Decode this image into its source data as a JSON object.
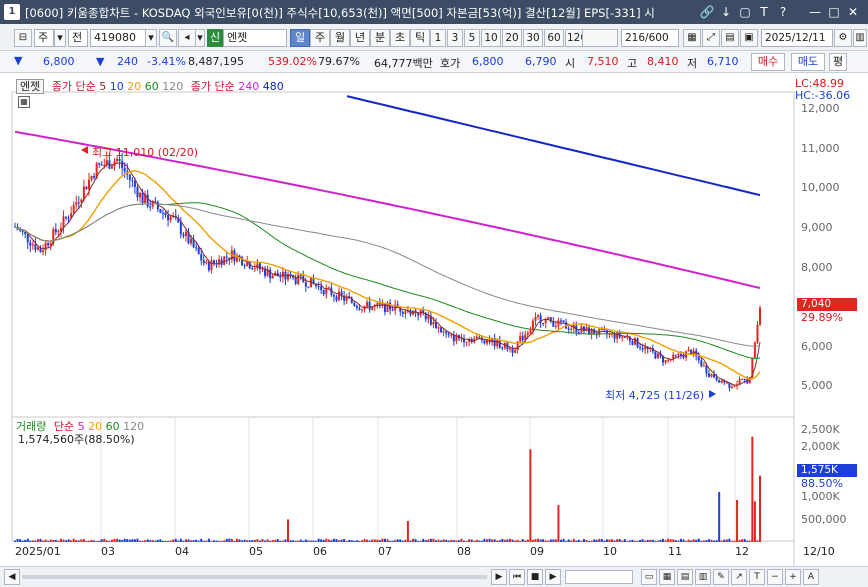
{
  "window": {
    "number": "1",
    "title": "[0600] 키움종합차트 - KOSDAQ 외국인보유[0(천)] 주식수[10,653(천)] 액면[500] 자본금[53(억)] 결산[12월] EPS[-331] 시",
    "buttons": [
      "🔗",
      "↓",
      "▢",
      "T",
      "?",
      "—",
      "□",
      "✕"
    ]
  },
  "toolbar": {
    "market_type": "주",
    "market_scope": "전",
    "stock_code": "419080",
    "credit_label": "신",
    "stock_name": "엔젯",
    "periods": [
      "일",
      "주",
      "월",
      "년",
      "분",
      "초",
      "틱"
    ],
    "active_period": "일",
    "intervals": [
      "1",
      "3",
      "5",
      "10",
      "20",
      "30",
      "60",
      "120"
    ],
    "count": "216/600",
    "date": "2025/12/11"
  },
  "quote": {
    "price": "6,800",
    "change": "240",
    "change_pct": "-3.41%",
    "volume": "8,487,195",
    "volume_ratio": "539.02%",
    "turnover": "79.67%",
    "amount": "64,777백만",
    "ask_label": "호가",
    "ask": "6,800",
    "bid": "6,790",
    "open_label": "시",
    "open": "7,510",
    "high_label": "고",
    "high": "8,410",
    "low_label": "저",
    "low": "6,710",
    "buy_label": "매수",
    "sell_label": "매도",
    "eval_label": "평"
  },
  "price_panel": {
    "stock_tag": "엔젯",
    "legend1_prefix": "종가 단순",
    "legend1_periods": [
      "5",
      "10",
      "20",
      "60",
      "120"
    ],
    "legend2_prefix": "종가 단순",
    "legend2_periods": [
      "240",
      "480"
    ],
    "lc": "LC:48.99",
    "hc": "HC:-36.06",
    "high_note": "최고 11,010 (02/20)",
    "low_note": "최저 4,725 (11/26)",
    "current_price_tag": "7,040",
    "current_pct": "29.89%",
    "yticks": [
      "12,000",
      "11,000",
      "10,000",
      "9,000",
      "8,000",
      "7,000",
      "6,000",
      "5,000"
    ]
  },
  "volume_panel": {
    "legend_prefix": "거래량",
    "legend_ma": "단순",
    "periods": [
      "5",
      "20",
      "60",
      "120"
    ],
    "current_volume": "1,574,560주(88.50%)",
    "tag_value": "1,575K",
    "tag_pct": "88.50%",
    "yticks": [
      "2,500K",
      "2,000K",
      "1,500K",
      "1,000K",
      "500,000"
    ]
  },
  "x_axis": {
    "labels": [
      "2025/01",
      "03",
      "04",
      "05",
      "06",
      "07",
      "08",
      "09",
      "10",
      "11",
      "12",
      "12/10"
    ]
  },
  "chart_data": {
    "type": "candlestick",
    "title": "엔젯 일봉",
    "ylim": [
      4500,
      12500
    ],
    "moving_averages": {
      "ma240_approx": {
        "color": "#d020d0",
        "start": 11400,
        "end": 7450
      },
      "ma480_approx": {
        "color": "#1426c8",
        "start": 12300,
        "end": 9800
      }
    },
    "key_points": {
      "high": {
        "value": 11010,
        "date": "02/20"
      },
      "low": {
        "value": 4725,
        "date": "11/26"
      },
      "last": 7040
    }
  },
  "colors": {
    "up": "#e0261f",
    "down": "#1b3fd8",
    "ma5": "#8a2a2a",
    "ma20": "#f0a000",
    "ma60": "#1e8a1e",
    "ma120": "#888888",
    "ma240": "#d020d0",
    "ma480": "#1426c8"
  }
}
